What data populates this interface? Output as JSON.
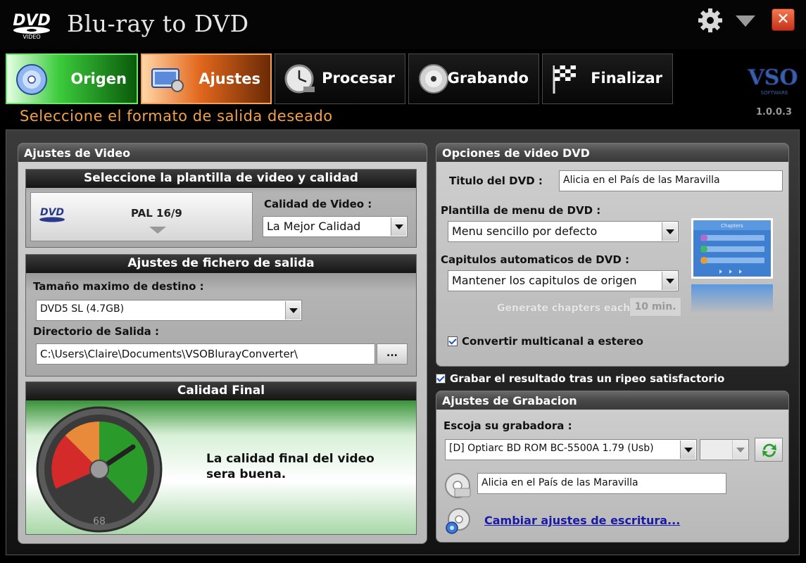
{
  "app": {
    "logo_text": "DVD",
    "logo_sub": "VIDEO",
    "title": "Blu-ray to DVD",
    "close_label": "✕",
    "brand": "VSO",
    "brand_sub": "SOFTWARE",
    "version": "1.0.0.3"
  },
  "steps": [
    {
      "label": "Origen",
      "icon": "disc-icon",
      "state": "done"
    },
    {
      "label": "Ajustes",
      "icon": "settings-icon",
      "state": "active"
    },
    {
      "label": "Procesar",
      "icon": "clock-icon",
      "state": "pending"
    },
    {
      "label": "Grabando",
      "icon": "burn-disc-icon",
      "state": "pending"
    },
    {
      "label": "Finalizar",
      "icon": "checkered-flag-icon",
      "state": "pending"
    }
  ],
  "instruction": "Seleccione el formato de salida deseado",
  "video_settings": {
    "title": "Ajustes de Video",
    "template": {
      "title": "Seleccione la plantilla de video y calidad",
      "logo": "DVD",
      "format": "PAL 16/9",
      "quality_label": "Calidad de Video :",
      "quality_value": "La Mejor Calidad"
    },
    "output": {
      "title": "Ajustes de fichero de salida",
      "max_size_label": "Tamaño maximo de destino :",
      "max_size_value": "DVD5 SL (4.7GB)",
      "dir_label": "Directorio de Salida :",
      "dir_value": "C:\\Users\\Claire\\Documents\\VSOBlurayConverter\\",
      "browse_label": "..."
    },
    "quality_final": {
      "title": "Calidad Final",
      "gauge_value": "68",
      "message": "La calidad final del video sera buena."
    }
  },
  "dvd_options": {
    "title": "Opciones de video DVD",
    "dvd_title_label": "Titulo del DVD :",
    "dvd_title_value": "Alicia en el País de las Maravilla",
    "menu_label": "Plantilla de menu de DVD :",
    "menu_value": "Menu sencillo por defecto",
    "chapters_label": "Capitulos automaticos de DVD :",
    "chapters_value": "Mantener los capitulos de origen",
    "gen_chapters_label": "Generate chapters each :",
    "gen_chapters_value": "10 min.",
    "menu_preview_title": "Chapters",
    "multichannel_label": "Convertir multicanal a estereo",
    "multichannel_checked": true
  },
  "burn_after": {
    "label": "Grabar el resultado tras un ripeo satisfactorio",
    "checked": true
  },
  "burn_settings": {
    "title": "Ajustes de Grabacion",
    "recorder_label": "Escoja su grabadora :",
    "recorder_value": "[D] Optiarc BD ROM BC-5500A 1.79 (Usb)",
    "speed_value": "",
    "disc_label_value": "Alicia en el País de las Maravilla",
    "change_settings_link": "Cambiar ajustes de escritura..."
  },
  "colors": {
    "accent_orange": "#f0a14a",
    "active_green": "#3ccb3c",
    "active_orange": "#e2671d",
    "link_blue": "#1a1aa8"
  }
}
